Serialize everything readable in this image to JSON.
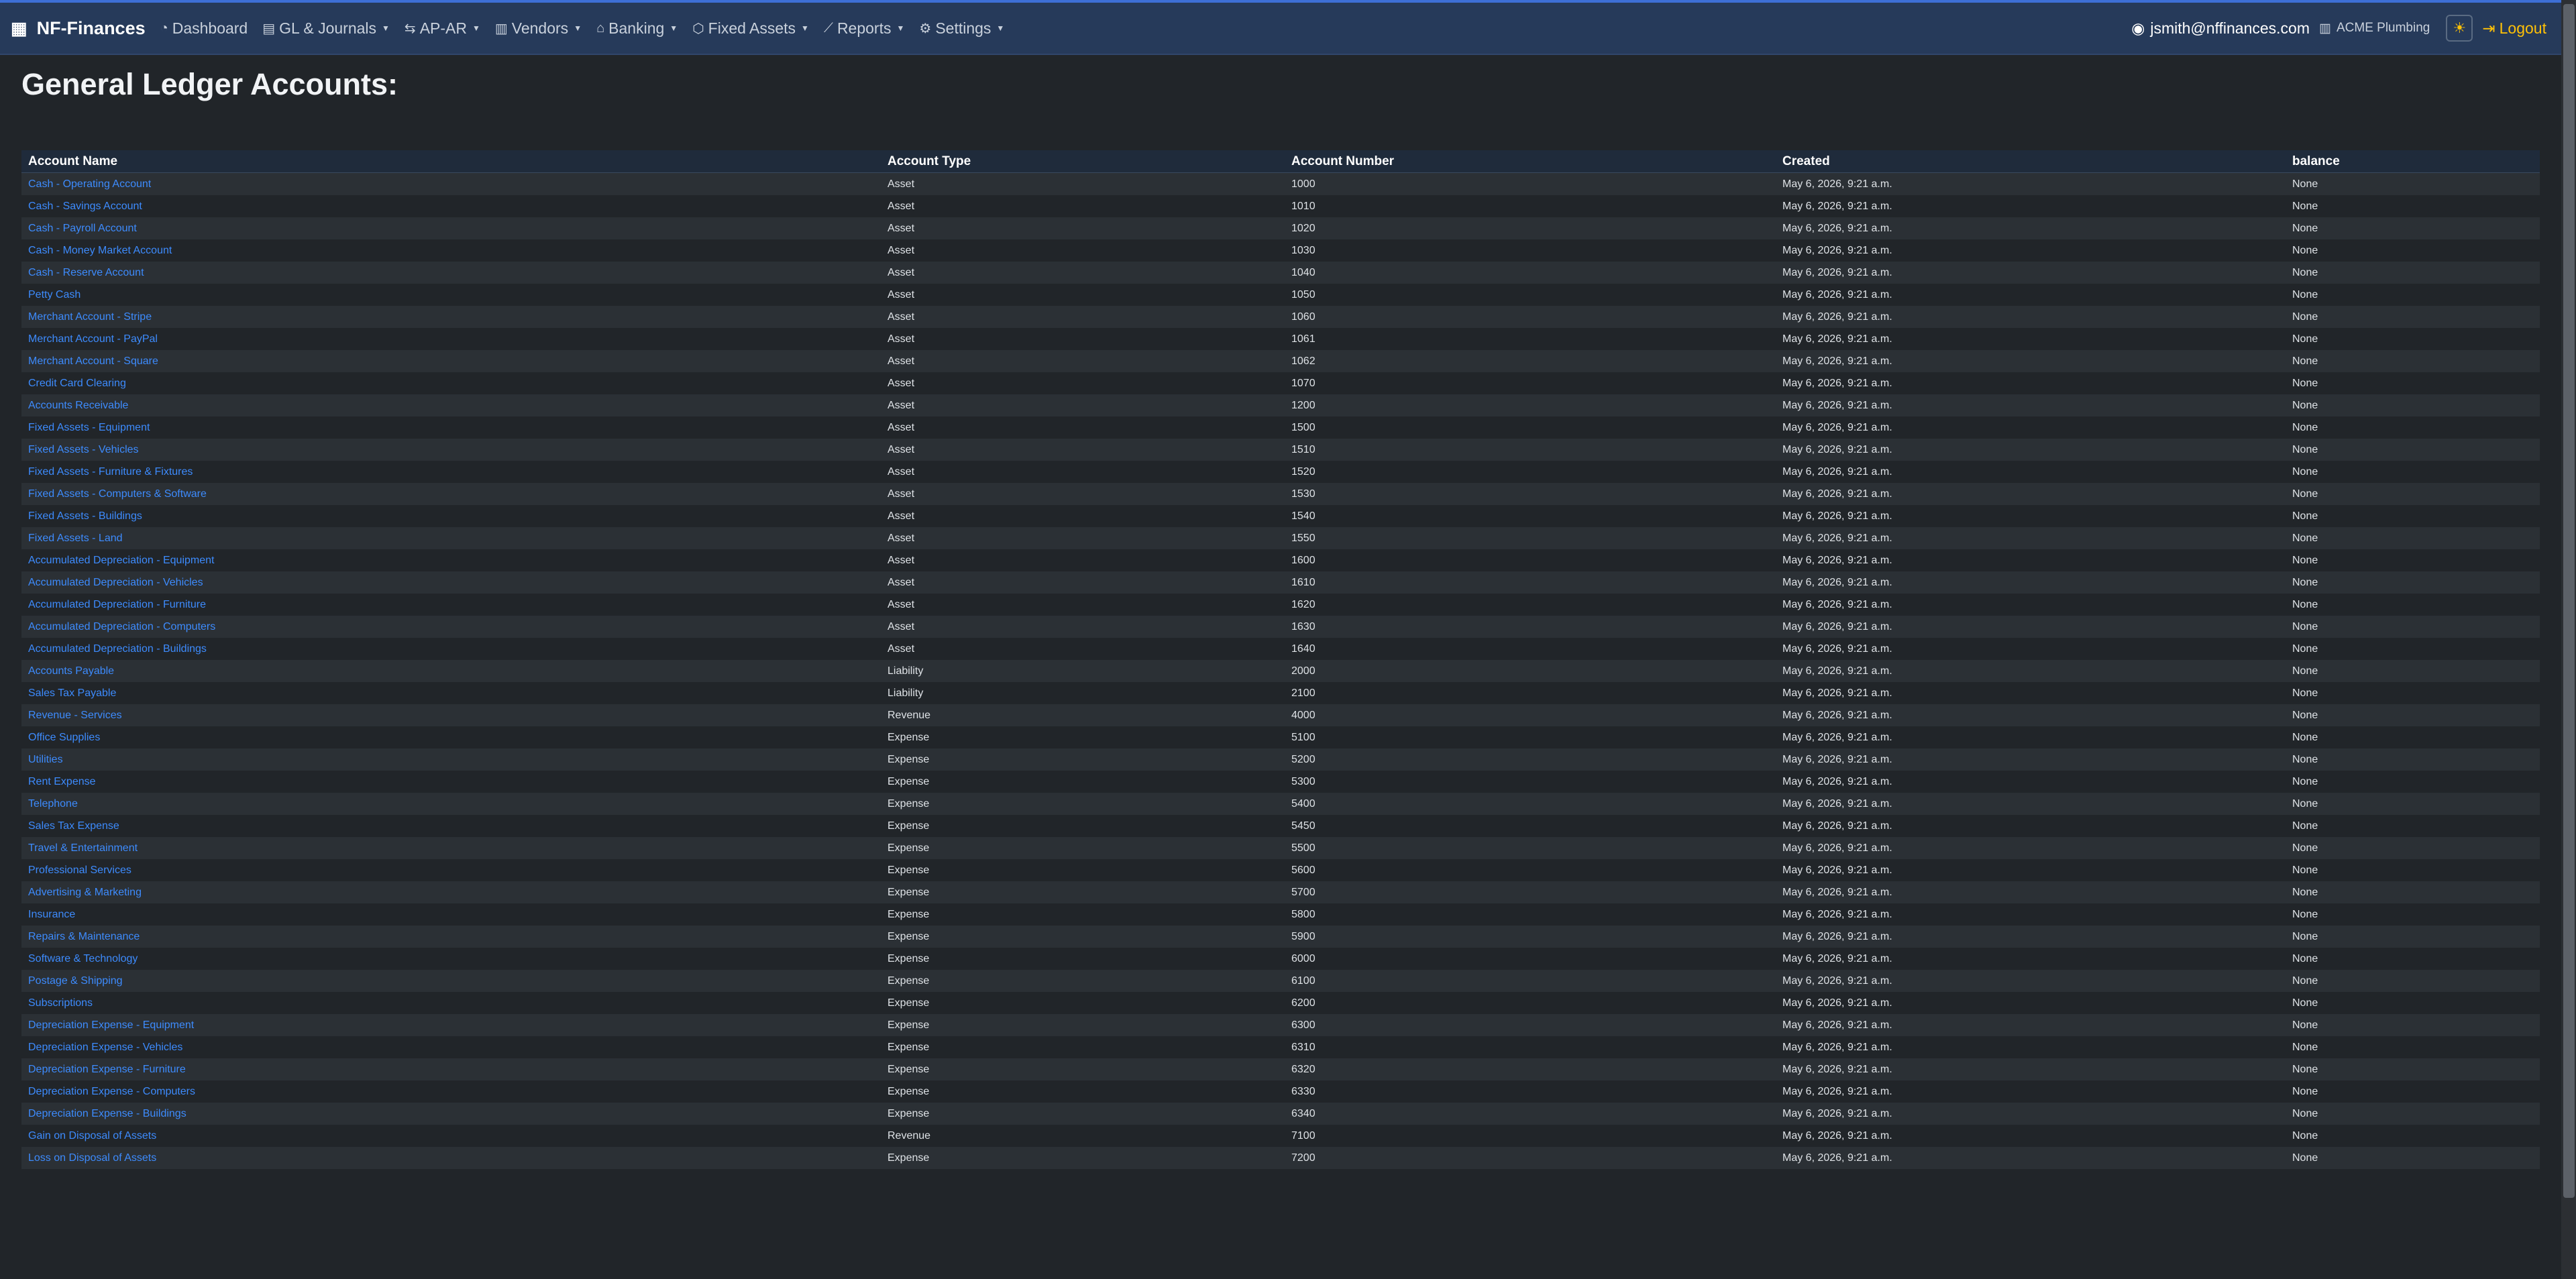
{
  "brand": "NF-Finances",
  "nav": [
    {
      "label": "Dashboard",
      "icon": "speedometer-icon",
      "dropdown": false
    },
    {
      "label": "GL & Journals",
      "icon": "journal-icon",
      "dropdown": true
    },
    {
      "label": "AP-AR",
      "icon": "arrows-exchange-icon",
      "dropdown": true
    },
    {
      "label": "Vendors",
      "icon": "building-icon",
      "dropdown": true
    },
    {
      "label": "Banking",
      "icon": "bank-icon",
      "dropdown": true
    },
    {
      "label": "Fixed Assets",
      "icon": "box-icon",
      "dropdown": true
    },
    {
      "label": "Reports",
      "icon": "chart-line-icon",
      "dropdown": true
    },
    {
      "label": "Settings",
      "icon": "gear-icon",
      "dropdown": true
    }
  ],
  "user": {
    "email": "jsmith@nffinances.com",
    "company": "ACME Plumbing",
    "logout": "Logout"
  },
  "page_title": "General Ledger Accounts:",
  "table": {
    "headers": [
      "Account Name",
      "Account Type",
      "Account Number",
      "Created",
      "balance"
    ],
    "rows": [
      [
        "Cash - Operating Account",
        "Asset",
        "1000",
        "May 6, 2026, 9:21 a.m.",
        "None"
      ],
      [
        "Cash - Savings Account",
        "Asset",
        "1010",
        "May 6, 2026, 9:21 a.m.",
        "None"
      ],
      [
        "Cash - Payroll Account",
        "Asset",
        "1020",
        "May 6, 2026, 9:21 a.m.",
        "None"
      ],
      [
        "Cash - Money Market Account",
        "Asset",
        "1030",
        "May 6, 2026, 9:21 a.m.",
        "None"
      ],
      [
        "Cash - Reserve Account",
        "Asset",
        "1040",
        "May 6, 2026, 9:21 a.m.",
        "None"
      ],
      [
        "Petty Cash",
        "Asset",
        "1050",
        "May 6, 2026, 9:21 a.m.",
        "None"
      ],
      [
        "Merchant Account - Stripe",
        "Asset",
        "1060",
        "May 6, 2026, 9:21 a.m.",
        "None"
      ],
      [
        "Merchant Account - PayPal",
        "Asset",
        "1061",
        "May 6, 2026, 9:21 a.m.",
        "None"
      ],
      [
        "Merchant Account - Square",
        "Asset",
        "1062",
        "May 6, 2026, 9:21 a.m.",
        "None"
      ],
      [
        "Credit Card Clearing",
        "Asset",
        "1070",
        "May 6, 2026, 9:21 a.m.",
        "None"
      ],
      [
        "Accounts Receivable",
        "Asset",
        "1200",
        "May 6, 2026, 9:21 a.m.",
        "None"
      ],
      [
        "Fixed Assets - Equipment",
        "Asset",
        "1500",
        "May 6, 2026, 9:21 a.m.",
        "None"
      ],
      [
        "Fixed Assets - Vehicles",
        "Asset",
        "1510",
        "May 6, 2026, 9:21 a.m.",
        "None"
      ],
      [
        "Fixed Assets - Furniture & Fixtures",
        "Asset",
        "1520",
        "May 6, 2026, 9:21 a.m.",
        "None"
      ],
      [
        "Fixed Assets - Computers & Software",
        "Asset",
        "1530",
        "May 6, 2026, 9:21 a.m.",
        "None"
      ],
      [
        "Fixed Assets - Buildings",
        "Asset",
        "1540",
        "May 6, 2026, 9:21 a.m.",
        "None"
      ],
      [
        "Fixed Assets - Land",
        "Asset",
        "1550",
        "May 6, 2026, 9:21 a.m.",
        "None"
      ],
      [
        "Accumulated Depreciation - Equipment",
        "Asset",
        "1600",
        "May 6, 2026, 9:21 a.m.",
        "None"
      ],
      [
        "Accumulated Depreciation - Vehicles",
        "Asset",
        "1610",
        "May 6, 2026, 9:21 a.m.",
        "None"
      ],
      [
        "Accumulated Depreciation - Furniture",
        "Asset",
        "1620",
        "May 6, 2026, 9:21 a.m.",
        "None"
      ],
      [
        "Accumulated Depreciation - Computers",
        "Asset",
        "1630",
        "May 6, 2026, 9:21 a.m.",
        "None"
      ],
      [
        "Accumulated Depreciation - Buildings",
        "Asset",
        "1640",
        "May 6, 2026, 9:21 a.m.",
        "None"
      ],
      [
        "Accounts Payable",
        "Liability",
        "2000",
        "May 6, 2026, 9:21 a.m.",
        "None"
      ],
      [
        "Sales Tax Payable",
        "Liability",
        "2100",
        "May 6, 2026, 9:21 a.m.",
        "None"
      ],
      [
        "Revenue - Services",
        "Revenue",
        "4000",
        "May 6, 2026, 9:21 a.m.",
        "None"
      ],
      [
        "Office Supplies",
        "Expense",
        "5100",
        "May 6, 2026, 9:21 a.m.",
        "None"
      ],
      [
        "Utilities",
        "Expense",
        "5200",
        "May 6, 2026, 9:21 a.m.",
        "None"
      ],
      [
        "Rent Expense",
        "Expense",
        "5300",
        "May 6, 2026, 9:21 a.m.",
        "None"
      ],
      [
        "Telephone",
        "Expense",
        "5400",
        "May 6, 2026, 9:21 a.m.",
        "None"
      ],
      [
        "Sales Tax Expense",
        "Expense",
        "5450",
        "May 6, 2026, 9:21 a.m.",
        "None"
      ],
      [
        "Travel & Entertainment",
        "Expense",
        "5500",
        "May 6, 2026, 9:21 a.m.",
        "None"
      ],
      [
        "Professional Services",
        "Expense",
        "5600",
        "May 6, 2026, 9:21 a.m.",
        "None"
      ],
      [
        "Advertising & Marketing",
        "Expense",
        "5700",
        "May 6, 2026, 9:21 a.m.",
        "None"
      ],
      [
        "Insurance",
        "Expense",
        "5800",
        "May 6, 2026, 9:21 a.m.",
        "None"
      ],
      [
        "Repairs & Maintenance",
        "Expense",
        "5900",
        "May 6, 2026, 9:21 a.m.",
        "None"
      ],
      [
        "Software & Technology",
        "Expense",
        "6000",
        "May 6, 2026, 9:21 a.m.",
        "None"
      ],
      [
        "Postage & Shipping",
        "Expense",
        "6100",
        "May 6, 2026, 9:21 a.m.",
        "None"
      ],
      [
        "Subscriptions",
        "Expense",
        "6200",
        "May 6, 2026, 9:21 a.m.",
        "None"
      ],
      [
        "Depreciation Expense - Equipment",
        "Expense",
        "6300",
        "May 6, 2026, 9:21 a.m.",
        "None"
      ],
      [
        "Depreciation Expense - Vehicles",
        "Expense",
        "6310",
        "May 6, 2026, 9:21 a.m.",
        "None"
      ],
      [
        "Depreciation Expense - Furniture",
        "Expense",
        "6320",
        "May 6, 2026, 9:21 a.m.",
        "None"
      ],
      [
        "Depreciation Expense - Computers",
        "Expense",
        "6330",
        "May 6, 2026, 9:21 a.m.",
        "None"
      ],
      [
        "Depreciation Expense - Buildings",
        "Expense",
        "6340",
        "May 6, 2026, 9:21 a.m.",
        "None"
      ],
      [
        "Gain on Disposal of Assets",
        "Revenue",
        "7100",
        "May 6, 2026, 9:21 a.m.",
        "None"
      ],
      [
        "Loss on Disposal of Assets",
        "Expense",
        "7200",
        "May 6, 2026, 9:21 a.m.",
        "None"
      ]
    ]
  }
}
